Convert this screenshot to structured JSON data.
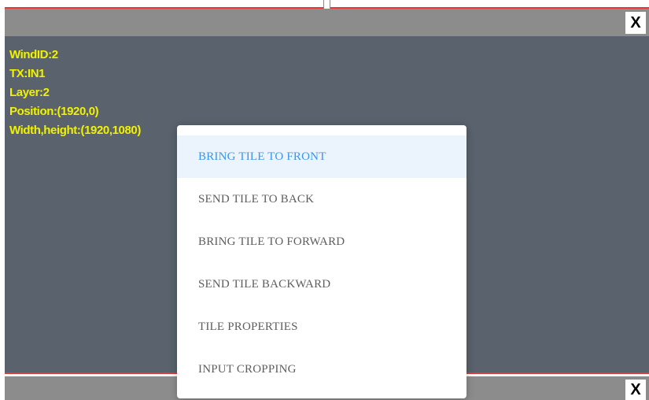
{
  "top_tile": {
    "close_label": "X",
    "info": {
      "wind_id": "WindID:2",
      "tx": "TX:IN1",
      "layer": "Layer:2",
      "position": "Position:(1920,0)",
      "size": "Width,height:(1920,1080)"
    }
  },
  "bottom_tile": {
    "close_label": "X"
  },
  "context_menu": {
    "items": [
      {
        "label": "BRING TILE TO FRONT",
        "highlighted": true
      },
      {
        "label": "SEND TILE TO BACK",
        "highlighted": false
      },
      {
        "label": "BRING TILE TO FORWARD",
        "highlighted": false
      },
      {
        "label": "SEND TILE BACKWARD",
        "highlighted": false
      },
      {
        "label": "TILE PROPERTIES",
        "highlighted": false
      },
      {
        "label": "INPUT CROPPING",
        "highlighted": false
      }
    ]
  },
  "colors": {
    "tile_body": "#59626d",
    "titlebar": "#8c8c8c",
    "info_text": "#f2f200",
    "border_line": "#e03a3a",
    "menu_highlight_bg": "#ebf4fc",
    "menu_highlight_text": "#3d95ea",
    "menu_text": "#5e5e5e"
  }
}
